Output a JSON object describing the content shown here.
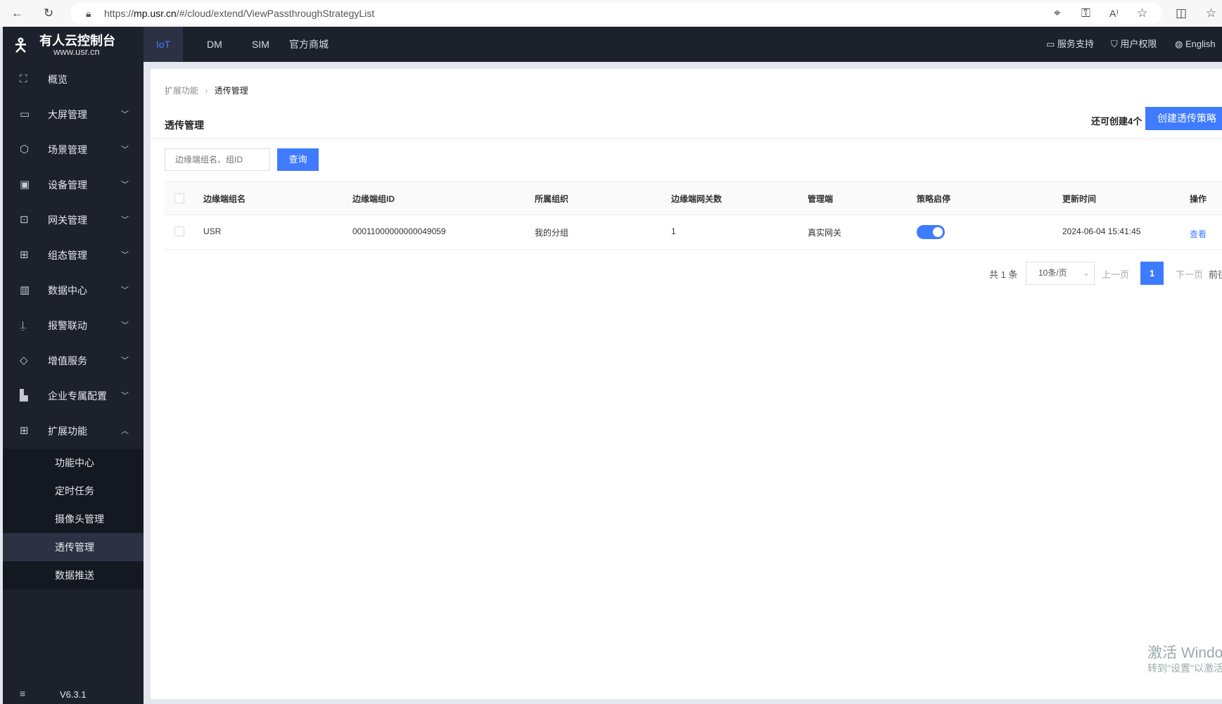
{
  "browser": {
    "url_prefix": "https://",
    "url_host": "mp.usr.cn",
    "url_path": "/#/cloud/extend/ViewPassthroughStrategyList"
  },
  "brand": {
    "name": "有人云控制台",
    "site": "www.usr.cn"
  },
  "topnav": {
    "tabs": [
      "IoT",
      "DM",
      "SIM",
      "官方商城"
    ],
    "active": "IoT",
    "support": "服务支持",
    "permissions": "用户权限",
    "language": "English"
  },
  "sidebar": {
    "items": [
      {
        "label": "概览",
        "icon": "overview-icon",
        "expandable": false
      },
      {
        "label": "大屏管理",
        "icon": "screen-icon",
        "expandable": true
      },
      {
        "label": "场景管理",
        "icon": "cube-icon",
        "expandable": true
      },
      {
        "label": "设备管理",
        "icon": "device-icon",
        "expandable": true
      },
      {
        "label": "网关管理",
        "icon": "gateway-icon",
        "expandable": true
      },
      {
        "label": "组态管理",
        "icon": "topology-icon",
        "expandable": true
      },
      {
        "label": "数据中心",
        "icon": "chart-icon",
        "expandable": true
      },
      {
        "label": "报警联动",
        "icon": "alarm-icon",
        "expandable": true
      },
      {
        "label": "增值服务",
        "icon": "diamond-icon",
        "expandable": true
      },
      {
        "label": "企业专属配置",
        "icon": "enterprise-icon",
        "expandable": true
      },
      {
        "label": "扩展功能",
        "icon": "grid-icon",
        "expandable": true,
        "expanded": true
      }
    ],
    "subitems": [
      "功能中心",
      "定时任务",
      "摄像头管理",
      "透传管理",
      "数据推送"
    ],
    "active_sub": "透传管理",
    "version": "V6.3.1"
  },
  "breadcrumb": [
    "扩展功能",
    "透传管理"
  ],
  "page": {
    "title": "透传管理",
    "remaining": "还可创建4个",
    "create_button": "创建透传策略"
  },
  "search": {
    "placeholder": "边缘端组名、组ID",
    "button": "查询"
  },
  "table": {
    "headers": [
      "边缘端组名",
      "边缘端组ID",
      "所属组织",
      "边缘端网关数",
      "管理端",
      "策略启停",
      "更新时间",
      "操作"
    ],
    "rows": [
      {
        "name": "USR",
        "id": "00011000000000049059",
        "org": "我的分组",
        "gateways": "1",
        "manager": "真实网关",
        "enabled": true,
        "updated": "2024-06-04 15:41:45",
        "action": "查看"
      }
    ]
  },
  "pagination": {
    "total": "共 1 条",
    "page_size": "10条/页",
    "prev": "上一页",
    "current": "1",
    "next": "下一页",
    "goto": "前往"
  },
  "watermark": {
    "line1": "激活 Windows",
    "line2": "转到\"设置\"以激活 Windows。"
  },
  "colors": {
    "accent": "#3e7bff",
    "nav_bg": "#1d212b"
  }
}
